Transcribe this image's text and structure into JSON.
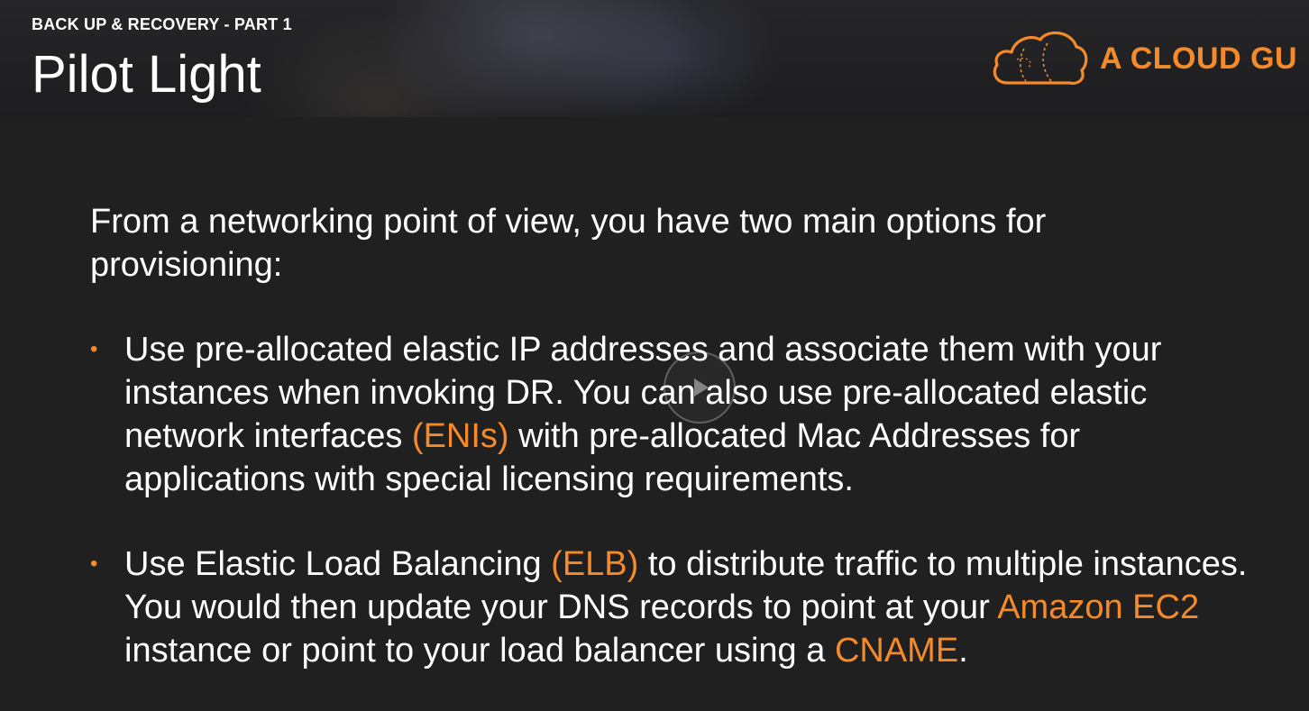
{
  "slide": {
    "section_label": "BACK UP & RECOVERY - PART 1",
    "title": "Pilot Light",
    "brand": {
      "name": "A CLOUD GU",
      "color": "#f58a2a",
      "logo_icon": "cloud-logo-icon"
    },
    "intro": "From a networking point of view, you have two main options for provisioning:",
    "bullets": [
      {
        "parts": [
          {
            "text": "Use pre-allocated elastic IP addresses and associate them with your instances when invoking DR. You can also use pre-allocated elastic network interfaces ",
            "highlight": false
          },
          {
            "text": "(ENIs)",
            "highlight": true
          },
          {
            "text": " with pre-allocated Mac Addresses for applications with special licensing requirements.",
            "highlight": false
          }
        ]
      },
      {
        "parts": [
          {
            "text": "Use Elastic Load Balancing ",
            "highlight": false
          },
          {
            "text": "(ELB)",
            "highlight": true
          },
          {
            "text": " to distribute traffic to multiple instances. You would then update your DNS records to point at your ",
            "highlight": false
          },
          {
            "text": "Amazon EC2",
            "highlight": true
          },
          {
            "text": " instance or point to your load balancer using a ",
            "highlight": false
          },
          {
            "text": "CNAME",
            "highlight": true
          },
          {
            "text": ".",
            "highlight": false
          }
        ]
      }
    ],
    "bullet_glyph": "•",
    "accent_color": "#f58a2a"
  },
  "player": {
    "play_icon": "play-icon"
  }
}
